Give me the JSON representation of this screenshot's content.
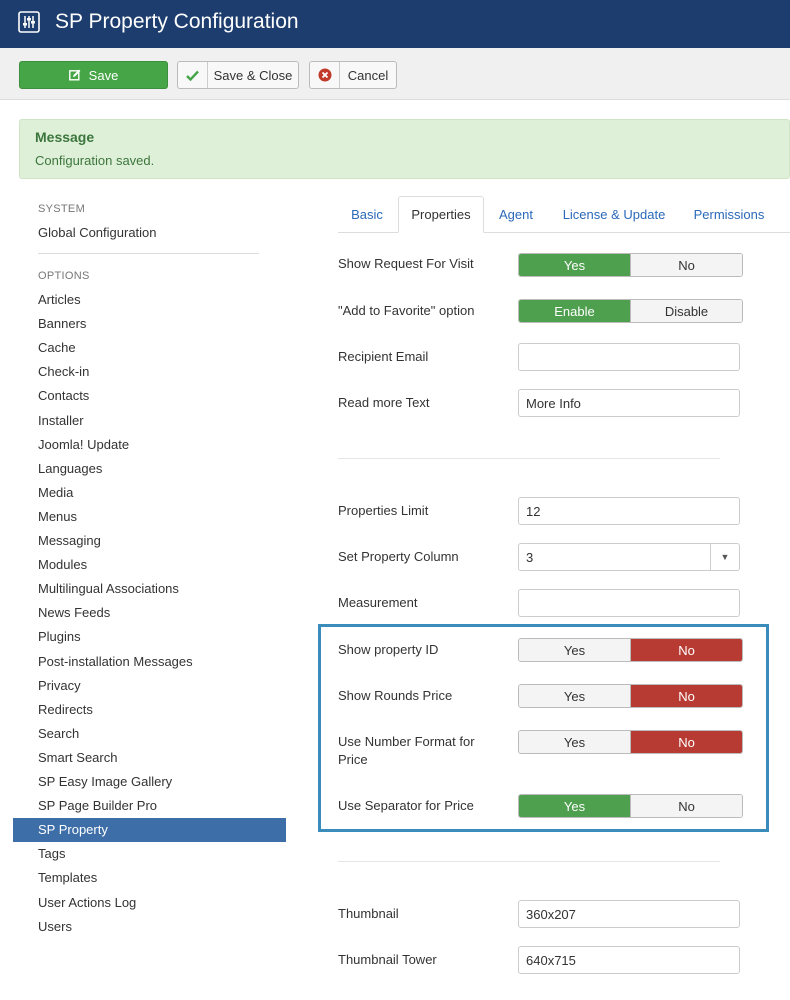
{
  "header": {
    "title": "SP Property Configuration",
    "icon": "sliders-icon"
  },
  "toolbar": {
    "save_label": "Save",
    "save_close_label": "Save & Close",
    "cancel_label": "Cancel"
  },
  "message": {
    "heading": "Message",
    "text": "Configuration saved."
  },
  "sidebar": {
    "system_heading": "SYSTEM",
    "system_items": [
      "Global Configuration"
    ],
    "options_heading": "OPTIONS",
    "items": [
      "Articles",
      "Banners",
      "Cache",
      "Check-in",
      "Contacts",
      "Installer",
      "Joomla! Update",
      "Languages",
      "Media",
      "Menus",
      "Messaging",
      "Modules",
      "Multilingual Associations",
      "News Feeds",
      "Plugins",
      "Post-installation Messages",
      "Privacy",
      "Redirects",
      "Search",
      "Smart Search",
      "SP Easy Image Gallery",
      "SP Page Builder Pro",
      "SP Property",
      "Tags",
      "Templates",
      "User Actions Log",
      "Users"
    ],
    "active_item": "SP Property"
  },
  "tabs": [
    "Basic",
    "Properties",
    "Agent",
    "License & Update",
    "Permissions"
  ],
  "active_tab": "Properties",
  "form": {
    "show_request": {
      "label": "Show Request For Visit",
      "yes": "Yes",
      "no": "No",
      "value": "Yes"
    },
    "add_favorite": {
      "label": "\"Add to Favorite\" option",
      "yes": "Enable",
      "no": "Disable",
      "value": "Enable"
    },
    "recipient_email": {
      "label": "Recipient Email",
      "value": ""
    },
    "read_more": {
      "label": "Read more Text",
      "value": "More Info"
    },
    "properties_limit": {
      "label": "Properties Limit",
      "value": "12"
    },
    "property_column": {
      "label": "Set Property Column",
      "value": "3"
    },
    "measurement": {
      "label": "Measurement",
      "value": ""
    },
    "show_property_id": {
      "label": "Show property ID",
      "yes": "Yes",
      "no": "No",
      "value": "No"
    },
    "show_rounds_price": {
      "label": "Show Rounds Price",
      "yes": "Yes",
      "no": "No",
      "value": "No"
    },
    "number_format": {
      "label": "Use Number Format for Price",
      "yes": "Yes",
      "no": "No",
      "value": "No"
    },
    "separator": {
      "label": "Use Separator for Price",
      "yes": "Yes",
      "no": "No",
      "value": "Yes"
    },
    "thumbnail": {
      "label": "Thumbnail",
      "value": "360x207"
    },
    "thumbnail_tower": {
      "label": "Thumbnail Tower",
      "value": "640x715"
    }
  },
  "colors": {
    "header": "#1c3d6e",
    "save_green": "#46a546",
    "on_green": "#4e9f4e",
    "on_red": "#b73b32",
    "active_blue": "#3d6ea8",
    "highlight": "#3a8cba"
  }
}
